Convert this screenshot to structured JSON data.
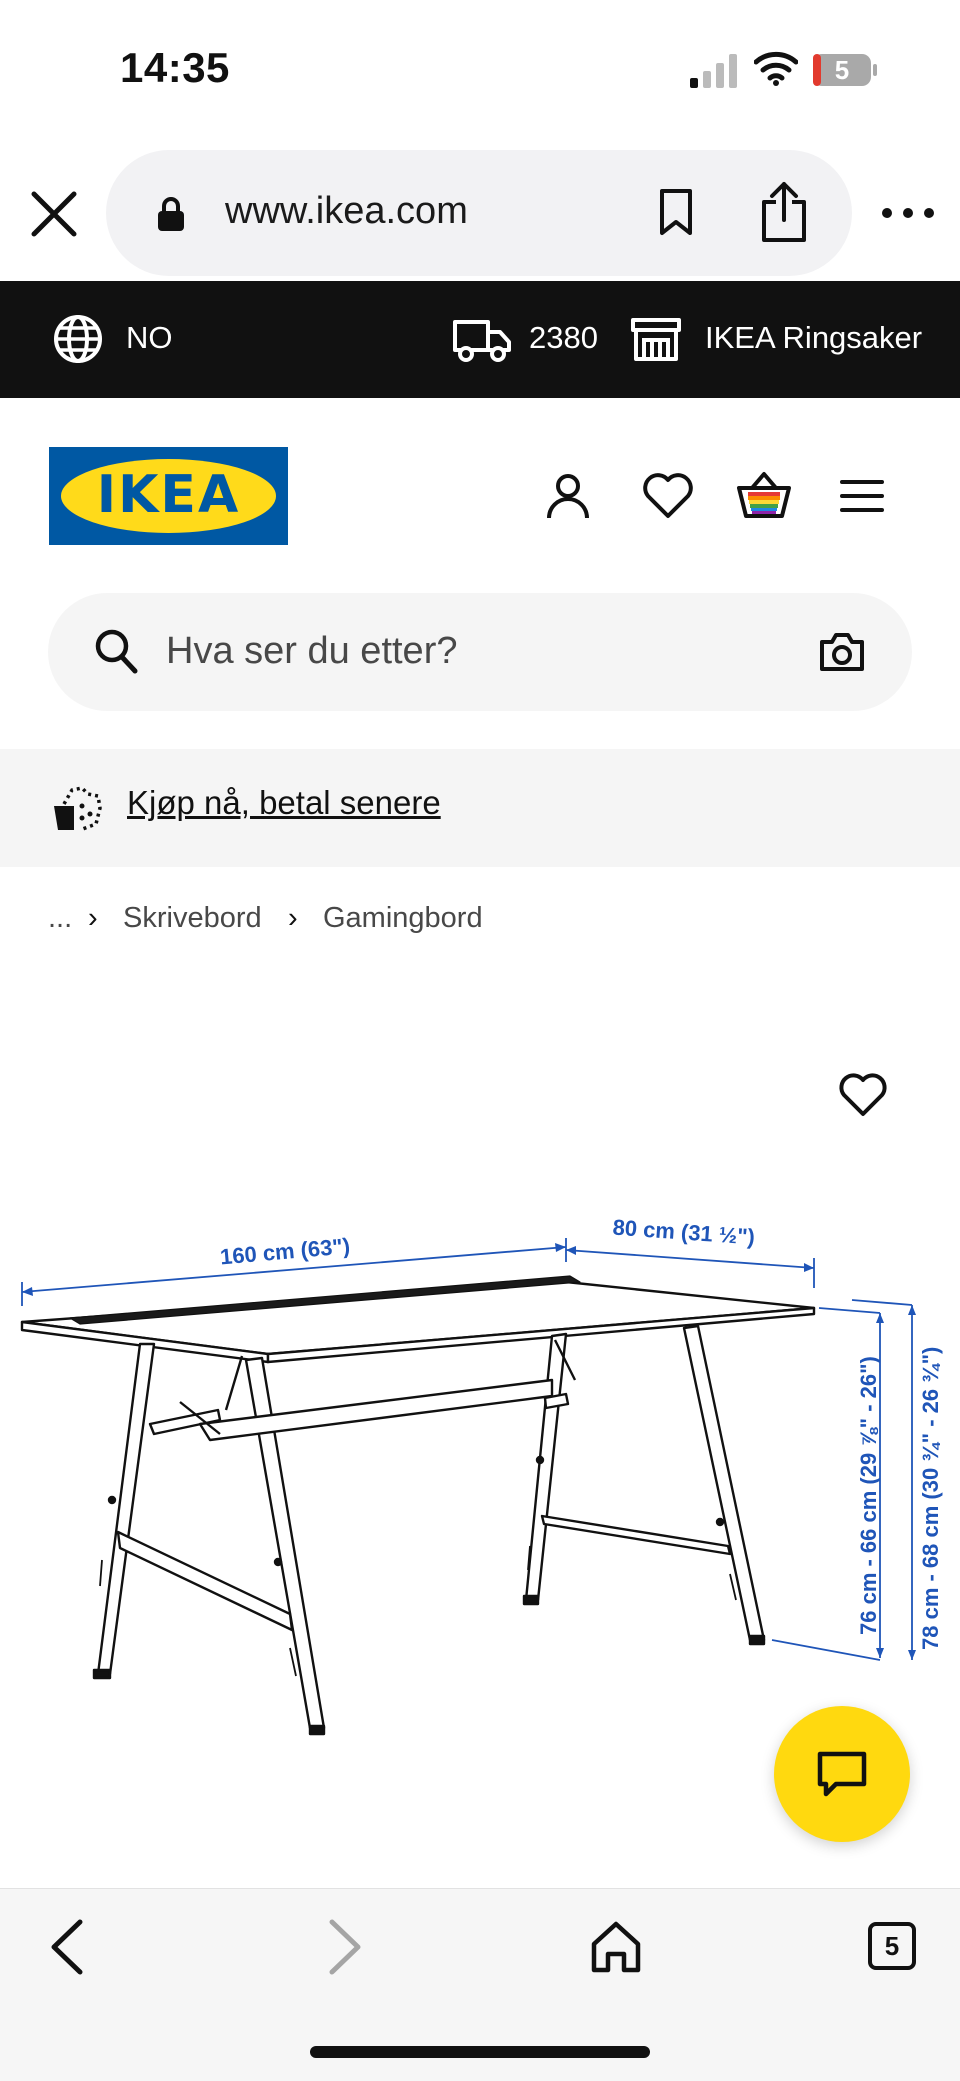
{
  "status_bar": {
    "time": "14:35",
    "battery": "5"
  },
  "browser": {
    "url": "www.ikea.com",
    "icons": [
      "close-icon",
      "lock-icon",
      "bookmark-icon",
      "share-icon",
      "more-icon"
    ]
  },
  "top_bar": {
    "country": "NO",
    "zip": "2380",
    "store": "IKEA Ringsaker"
  },
  "header": {
    "logo_text": "IKEA"
  },
  "search": {
    "placeholder": "Hva ser du etter?"
  },
  "promo": {
    "text": "Kjøp nå, betal senere"
  },
  "breadcrumb": {
    "ellipsis": "...",
    "separator": "›",
    "items": [
      "Skrivebord",
      "Gamingbord"
    ]
  },
  "product_image": {
    "dimensions": {
      "width": "160 cm (63\")",
      "depth": "80 cm (31 ½\")",
      "height_tabletop": "76 cm - 66 cm (29 ⅞\" - 26\")",
      "height_total": "78 cm - 68 cm (30 ¾\" - 26 ¾\")"
    }
  },
  "bottom_nav": {
    "tab_count": "5"
  },
  "colors": {
    "ikea_blue": "#0058a3",
    "ikea_yellow": "#ffda1a",
    "dimension_blue": "#1f55b8",
    "chat_yellow": "#ffd90f"
  }
}
